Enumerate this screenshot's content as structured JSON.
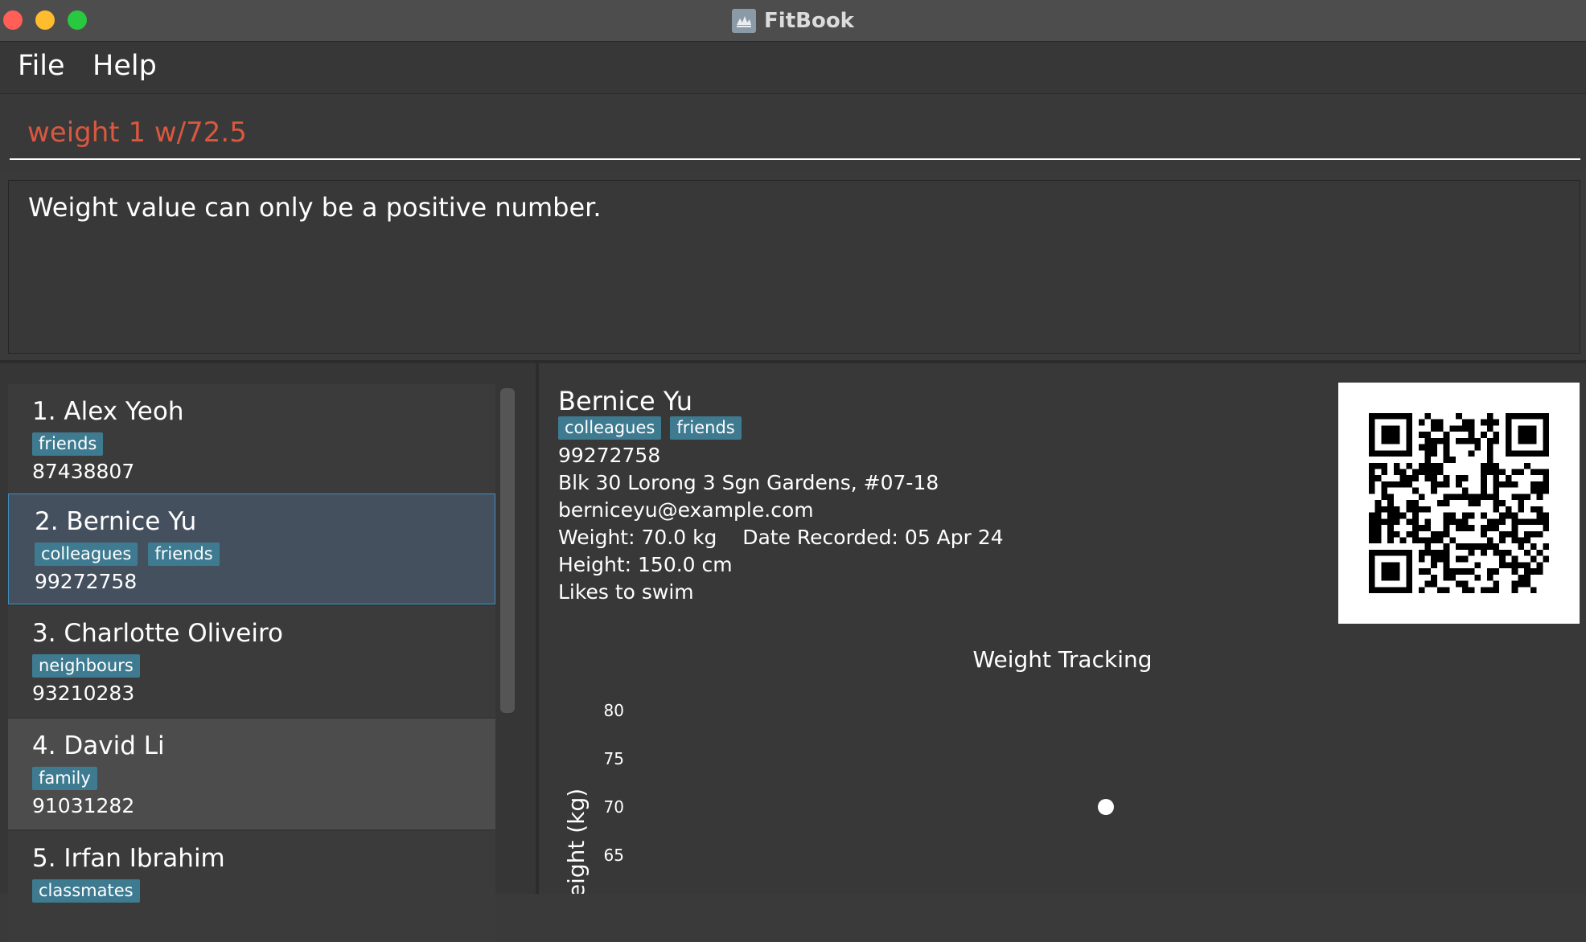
{
  "window": {
    "title": "FitBook"
  },
  "menu": {
    "file": "File",
    "help": "Help"
  },
  "command": {
    "value": "weight 1 w/72.5"
  },
  "result": {
    "message": "Weight value can only be a positive number."
  },
  "persons": [
    {
      "name": "1. Alex Yeoh",
      "tags": [
        "friends"
      ],
      "phone": "87438807"
    },
    {
      "name": "2. Bernice Yu",
      "tags": [
        "colleagues",
        "friends"
      ],
      "phone": "99272758"
    },
    {
      "name": "3. Charlotte Oliveiro",
      "tags": [
        "neighbours"
      ],
      "phone": "93210283"
    },
    {
      "name": "4. David Li",
      "tags": [
        "family"
      ],
      "phone": "91031282"
    },
    {
      "name": "5. Irfan Ibrahim",
      "tags": [
        "classmates"
      ],
      "phone": ""
    }
  ],
  "detail": {
    "name": "Bernice Yu",
    "tags": [
      "colleagues",
      "friends"
    ],
    "phone": "99272758",
    "address": "Blk 30 Lorong 3 Sgn Gardens, #07-18",
    "email": "berniceyu@example.com",
    "weight_line": "Weight: 70.0 kg    Date Recorded: 05 Apr 24",
    "height_line": "Height: 150.0 cm",
    "note": "Likes to swim"
  },
  "colors": {
    "tag": "#3e7b91",
    "selection_border": "#3e8ec4",
    "command_text": "#d9583f"
  },
  "chart_data": {
    "type": "scatter",
    "title": "Weight Tracking",
    "ylabel": "Weight (kg)",
    "xlabel": "",
    "yticks": [
      65,
      70,
      75,
      80
    ],
    "ylim": [
      65,
      80
    ],
    "series": [
      {
        "values": [
          70.0
        ]
      }
    ]
  }
}
